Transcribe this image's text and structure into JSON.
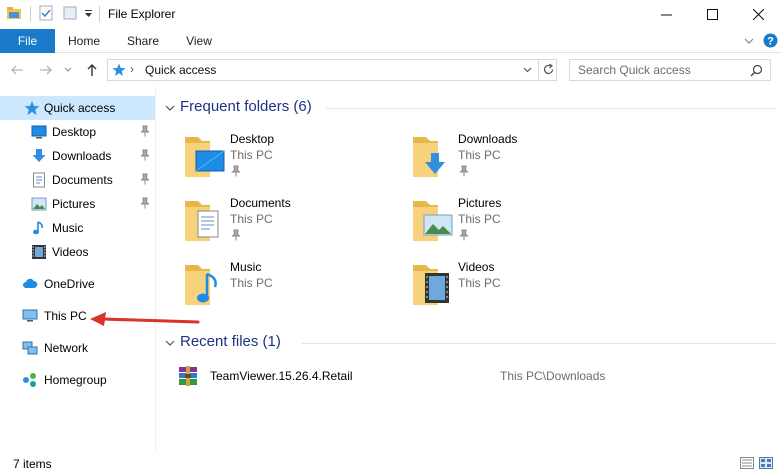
{
  "window": {
    "title": "File Explorer",
    "minimize_icon": "minimize-icon",
    "maximize_icon": "maximize-icon",
    "close_icon": "close-icon"
  },
  "ribbon": {
    "tabs": [
      {
        "label": "File",
        "active": true
      },
      {
        "label": "Home"
      },
      {
        "label": "Share"
      },
      {
        "label": "View"
      }
    ]
  },
  "address": {
    "breadcrumb": "Quick access",
    "search_placeholder": "Search Quick access"
  },
  "sidebar": {
    "items": [
      {
        "label": "Quick access",
        "icon": "star-icon",
        "selected": true
      },
      {
        "label": "Desktop",
        "icon": "desktop-icon",
        "pinned": true
      },
      {
        "label": "Downloads",
        "icon": "download-icon",
        "pinned": true
      },
      {
        "label": "Documents",
        "icon": "documents-icon",
        "pinned": true
      },
      {
        "label": "Pictures",
        "icon": "pictures-icon",
        "pinned": true
      },
      {
        "label": "Music",
        "icon": "music-icon"
      },
      {
        "label": "Videos",
        "icon": "videos-icon"
      },
      {
        "label": "OneDrive",
        "icon": "cloud-icon"
      },
      {
        "label": "This PC",
        "icon": "pc-icon"
      },
      {
        "label": "Network",
        "icon": "network-icon"
      },
      {
        "label": "Homegroup",
        "icon": "homegroup-icon"
      }
    ]
  },
  "frequent": {
    "heading": "Frequent folders (6)",
    "folders": [
      {
        "name": "Desktop",
        "location": "This PC",
        "icon": "desktop-folder-icon"
      },
      {
        "name": "Downloads",
        "location": "This PC",
        "icon": "downloads-folder-icon"
      },
      {
        "name": "Documents",
        "location": "This PC",
        "icon": "documents-folder-icon"
      },
      {
        "name": "Pictures",
        "location": "This PC",
        "icon": "pictures-folder-icon"
      },
      {
        "name": "Music",
        "location": "This PC",
        "icon": "music-folder-icon"
      },
      {
        "name": "Videos",
        "location": "This PC",
        "icon": "videos-folder-icon"
      }
    ]
  },
  "recent": {
    "heading": "Recent files (1)",
    "files": [
      {
        "name": "TeamViewer.15.26.4.Retail",
        "path": "This PC\\Downloads",
        "icon": "winrar-archive-icon"
      }
    ]
  },
  "status": {
    "count": "7 items"
  },
  "colors": {
    "accent": "#1979ca",
    "selection": "#cce8ff",
    "group_heading": "#1e3287",
    "annotation_arrow": "#d9332b"
  }
}
